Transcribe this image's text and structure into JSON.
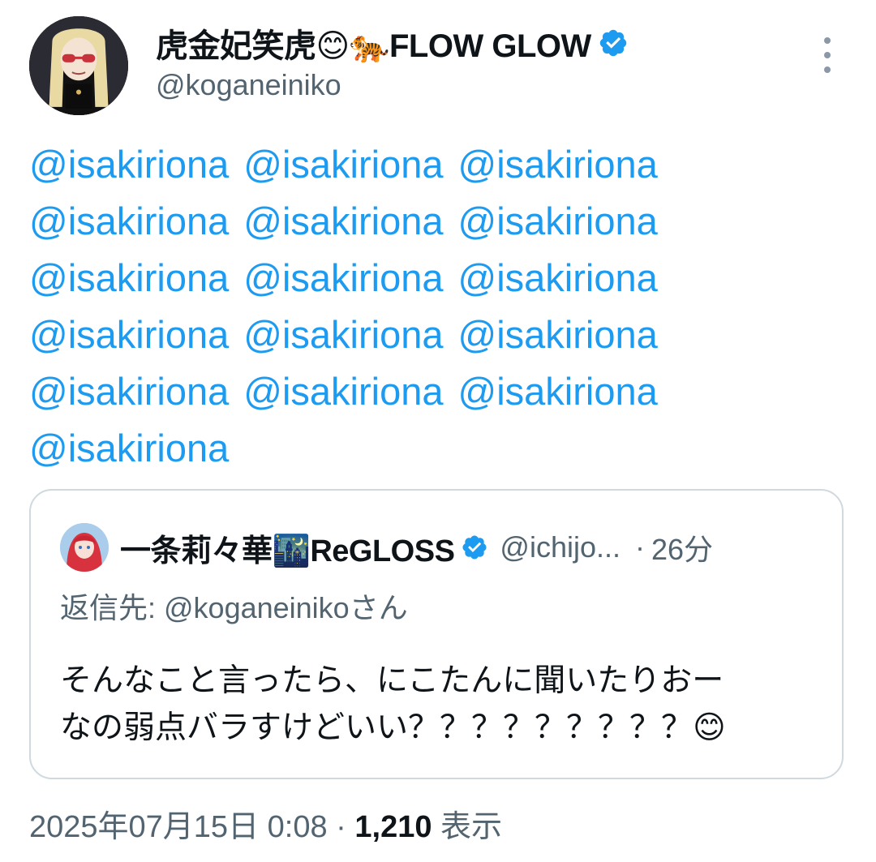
{
  "tweet": {
    "author": {
      "display_name": "虎金妃笑虎😊🐅FLOW GLOW",
      "handle": "@koganeiniko",
      "verified": true
    },
    "mentions": [
      [
        "@isakiriona",
        "@isakiriona",
        "@isakiriona"
      ],
      [
        "@isakiriona",
        "@isakiriona",
        "@isakiriona"
      ],
      [
        "@isakiriona",
        "@isakiriona",
        "@isakiriona"
      ],
      [
        "@isakiriona",
        "@isakiriona",
        "@isakiriona"
      ],
      [
        "@isakiriona",
        "@isakiriona",
        "@isakiriona"
      ],
      [
        "@isakiriona"
      ]
    ],
    "quoted": {
      "display_name": "一条莉々華🌃ReGLOSS",
      "handle": "@ichijo...",
      "separator": "·",
      "time": "26分",
      "verified": true,
      "replying_to": "返信先: @koganeinikoさん",
      "body_lines": [
        "そんなこと言ったら、にこたんに聞いたりおー",
        "なの弱点バラすけどいい？？？？？？？？？😊"
      ]
    },
    "timestamp": "2025年07月15日 0:08",
    "meta_separator": "·",
    "views_count": "1,210",
    "views_label": "表示"
  },
  "colors": {
    "link": "#1d9bf0",
    "verified": "#1d9bf0",
    "secondary_text": "#536471",
    "border": "#cfd9de"
  },
  "icons": {
    "verified": "verified-badge-icon",
    "more": "more-dots-vertical-icon"
  }
}
